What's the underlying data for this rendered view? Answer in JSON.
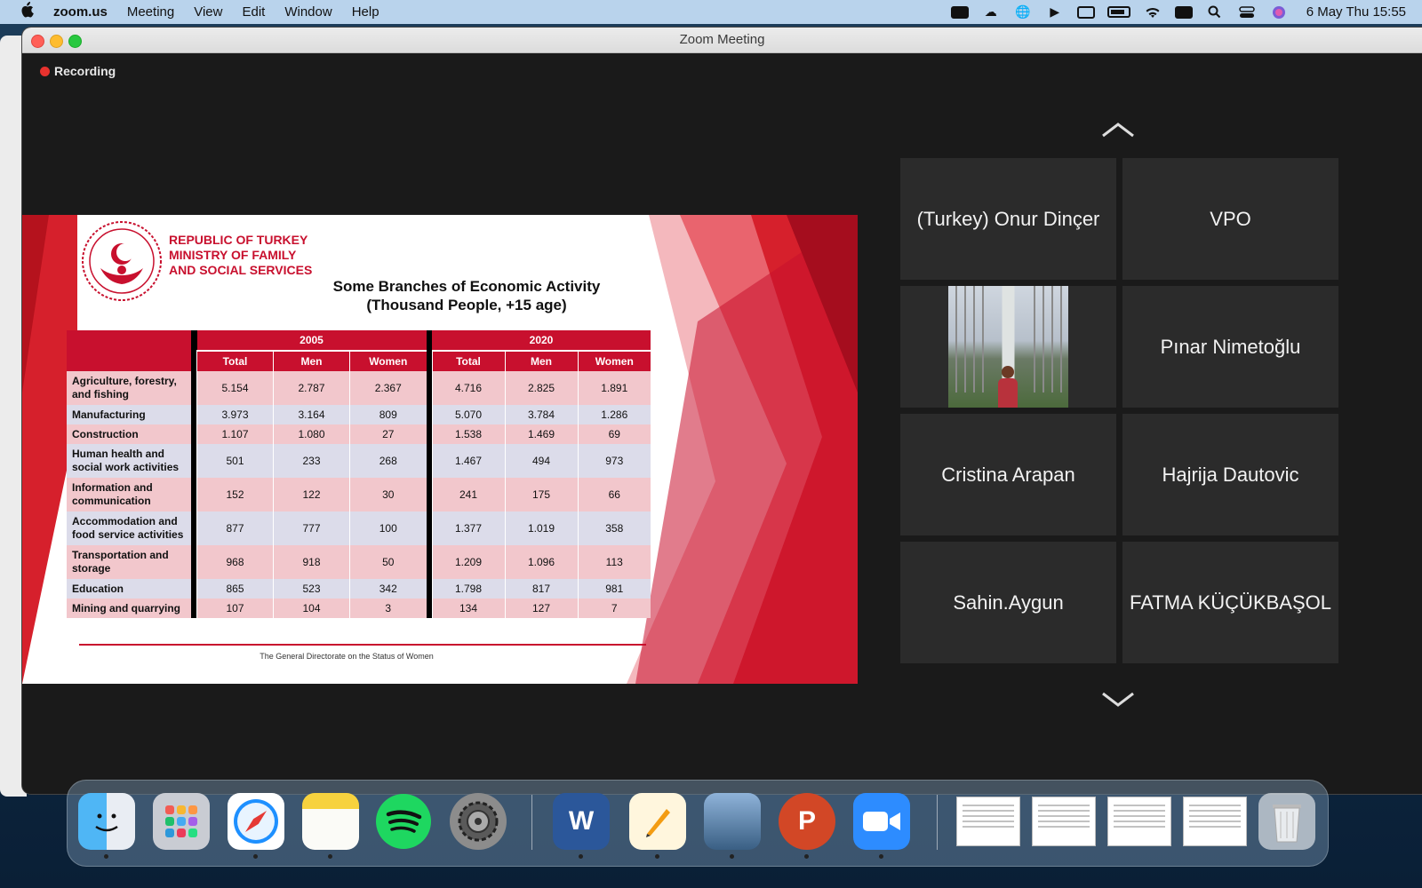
{
  "menubar": {
    "app_name": "zoom.us",
    "items": [
      "Meeting",
      "View",
      "Edit",
      "Window",
      "Help"
    ],
    "clock": "6 May Thu  15:55",
    "status_icons": [
      "zoom-icon",
      "creative-cloud-icon",
      "vpn-globe-icon",
      "play-icon",
      "keyboard-icon",
      "battery-icon",
      "wifi-icon",
      "memory-icon",
      "search-icon",
      "control-center-icon",
      "siri-icon"
    ]
  },
  "window": {
    "title": "Zoom Meeting"
  },
  "recording": {
    "label": "Recording",
    "color": "#e8322e"
  },
  "slide": {
    "ministry_lines": [
      "REPUBLIC OF TURKEY",
      "MINISTRY OF FAMILY",
      "AND SOCIAL SERVICES"
    ],
    "title_line1": "Some Branches of Economic Activity",
    "title_line2": "(Thousand People, +15 age)",
    "footer": "The General Directorate on the Status of Women",
    "accent": "#c8102e",
    "years": [
      "2005",
      "2020"
    ],
    "columns": [
      "Total",
      "Men",
      "Women",
      "Total",
      "Men",
      "Women"
    ],
    "rows": [
      {
        "label": "Agriculture, forestry, and fishing",
        "values": [
          "5.154",
          "2.787",
          "2.367",
          "4.716",
          "2.825",
          "1.891"
        ]
      },
      {
        "label": "Manufacturing",
        "values": [
          "3.973",
          "3.164",
          "809",
          "5.070",
          "3.784",
          "1.286"
        ]
      },
      {
        "label": "Construction",
        "values": [
          "1.107",
          "1.080",
          "27",
          "1.538",
          "1.469",
          "69"
        ]
      },
      {
        "label": "Human health and social work activities",
        "values": [
          "501",
          "233",
          "268",
          "1.467",
          "494",
          "973"
        ]
      },
      {
        "label": "Information and communication",
        "values": [
          "152",
          "122",
          "30",
          "241",
          "175",
          "66"
        ]
      },
      {
        "label": "Accommodation and food service activities",
        "values": [
          "877",
          "777",
          "100",
          "1.377",
          "1.019",
          "358"
        ]
      },
      {
        "label": "Transportation and storage",
        "values": [
          "968",
          "918",
          "50",
          "1.209",
          "1.096",
          "113"
        ]
      },
      {
        "label": "Education",
        "values": [
          "865",
          "523",
          "342",
          "1.798",
          "817",
          "981"
        ]
      },
      {
        "label": "Mining and quarrying",
        "values": [
          "107",
          "104",
          "3",
          "134",
          "127",
          "7"
        ]
      }
    ]
  },
  "participants": [
    {
      "name": "(Turkey) Onur Dinçer",
      "video": false
    },
    {
      "name": "VPO",
      "video": false
    },
    {
      "name": "",
      "video": true
    },
    {
      "name": "Pınar Nimetoğlu",
      "video": false
    },
    {
      "name": "Cristina Arapan",
      "video": false
    },
    {
      "name": "Hajrija Dautovic",
      "video": false
    },
    {
      "name": "Sahin.Aygun",
      "video": false
    },
    {
      "name": "FATMA KÜÇÜKBAŞOL",
      "video": false
    }
  ],
  "dock": {
    "apps": [
      "finder",
      "launchpad",
      "safari",
      "notes",
      "spotify",
      "system-preferences",
      "word",
      "pages",
      "preview",
      "powerpoint",
      "zoom"
    ],
    "word_letter": "W",
    "powerpoint_letter": "P"
  }
}
